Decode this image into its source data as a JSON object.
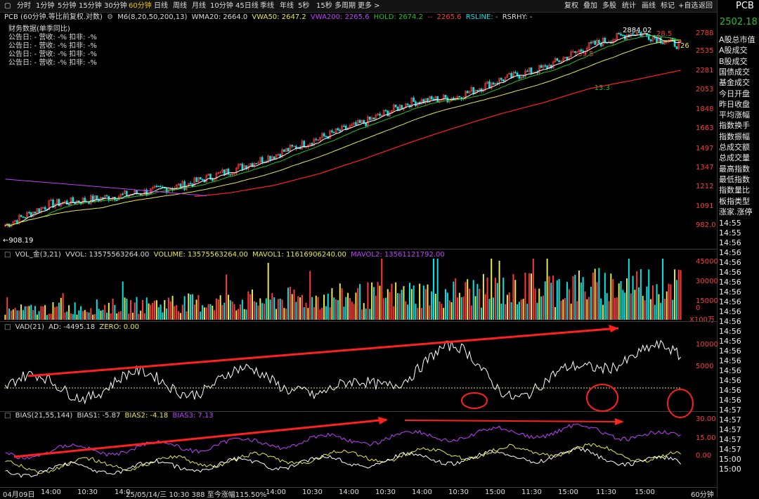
{
  "toolbar": {
    "periods": [
      "分时",
      "1分钟",
      "5分钟",
      "15分钟",
      "30分钟",
      "60分钟",
      "日线",
      "周线",
      "月线",
      "10分钟",
      "45日线",
      "季线",
      "年线",
      "5秒",
      "15秒",
      "多周期",
      "更多 >"
    ],
    "active_period": "60分钟",
    "right_buttons": [
      "复权",
      "叠加",
      "多股",
      "统计",
      "画线",
      "标记",
      "+自选",
      "返回"
    ]
  },
  "colors": {
    "bg": "#000000",
    "up": "#ff3b3b",
    "down": "#00e5e5",
    "yellow": "#e8e84a",
    "purple": "#c040ff",
    "green": "#21c421",
    "white": "#ffffff",
    "red_ma": "#ff2020",
    "active_tab": "#e8c200"
  },
  "main": {
    "header": {
      "name": "PCB (60分钟.等比前复权.对数)",
      "m6": "M6(8,20,50,200,13)",
      "wma20": "WMA20: 2664.0",
      "vwa50": "VWA50: 2647.2",
      "vwa200": "VWA200: 2265.6",
      "hold": "HOLD: 2674.2",
      "hold_sep": "--",
      "hold2": "2265.6",
      "rsline": "RSLINE: -",
      "rsrhy": "RSRHY: -"
    },
    "finance": {
      "title": "财务数据(单季同比)",
      "rows": [
        "公告日: - 营收: -% 扣非: -%",
        "公告日: - 营收: -% 扣非: -%",
        "公告日: - 营收: -% 扣非: -%",
        "公告日: - 营收: -% 扣非: -%"
      ]
    },
    "yaxis": [
      "2788",
      "2535",
      "2281",
      "2053",
      "1848",
      "1663",
      "1497",
      "1347",
      "1212",
      "1091",
      "982.0"
    ],
    "annotations": {
      "high": "2884.02",
      "low": "←908.19",
      "a1": "159.5",
      "a2": "-13.3",
      "a3": "28.5",
      "a4": "26"
    }
  },
  "vol": {
    "header": {
      "name": "VOL_金(3,21)",
      "vvol": "VVOL: 13575563264.00",
      "volume": "VOLUME: 13575563264.00",
      "mavol1": "MAVOL1: 11616906240.00",
      "mavol2": "MAVOL2: 13561121792.00"
    },
    "yaxis": [
      "45000",
      "30000",
      "15000",
      "0"
    ],
    "unit": "X100万"
  },
  "vad": {
    "header": {
      "name": "VAD(21)",
      "ad": "AD: -4495.18",
      "zero": "ZERO: 0.00"
    },
    "yaxis": [
      "10000",
      "5000"
    ]
  },
  "bias": {
    "header": {
      "name": "BIAS(21,55,144)",
      "b1": "BIAS1: -5.87",
      "b2": "BIAS2: -4.18",
      "b3": "BIAS3: 7.13"
    },
    "yaxis": [
      "30.00",
      "15.00",
      "0.00"
    ]
  },
  "xaxis": {
    "labels": [
      "04月09日",
      "14:00",
      "10:30",
      "14:0",
      "25/05/14/三 10:30 388 至今涨幅115.50%",
      "14:00",
      "10:30",
      "14:00",
      "10:30",
      "14:00",
      "10:30",
      "15:00",
      "11:30",
      "15:00",
      "11:30",
      "15:00"
    ],
    "period": "60分钟"
  },
  "right_panel": {
    "title": "PCB",
    "price": "2502.18",
    "items": [
      "A股总市值",
      "A股成交",
      "B股成交",
      "国债成交",
      "基金成交",
      "今日开盘",
      "昨日收盘",
      "平均涨幅",
      "指数换手",
      "指数振幅",
      "总成交额",
      "总成交量",
      "最高指数",
      "最低指数",
      "指数量比",
      "板指类型",
      "涨家.涨停"
    ],
    "times": [
      "14:55",
      "14:55",
      "14:56",
      "14:56",
      "14:56",
      "14:56",
      "14:56",
      "14:56",
      "14:56",
      "14:56",
      "14:56",
      "14:56",
      "14:56",
      "14:56",
      "14:56",
      "14:56",
      "14:56",
      "14:56",
      "14:56",
      "14:57",
      "14:57",
      "14:57",
      "14:57",
      "14:57",
      "15:00",
      "15:00"
    ]
  },
  "chart_data": {
    "type": "line",
    "x": [
      "04月09日",
      "10:30",
      "14:00",
      "25/05/14",
      "10:30",
      "14:00",
      "10:30",
      "14:00",
      "10:30",
      "14:00",
      "10:30",
      "15:00",
      "11:30",
      "15:00",
      "11:30",
      "15:00"
    ],
    "series": [
      {
        "name": "close",
        "values": [
          960,
          1080,
          1110,
          1150,
          1200,
          1300,
          1420,
          1560,
          1700,
          1900,
          1950,
          2150,
          2300,
          2600,
          2800,
          2600
        ]
      },
      {
        "name": "VWA200",
        "values": [
          1230,
          1200,
          1160,
          1140,
          1120,
          1150,
          1200,
          1280,
          1390,
          1520,
          1650,
          1780,
          1900,
          2050,
          2150,
          2265.6
        ]
      }
    ],
    "ylim": [
      908,
      2884
    ]
  }
}
